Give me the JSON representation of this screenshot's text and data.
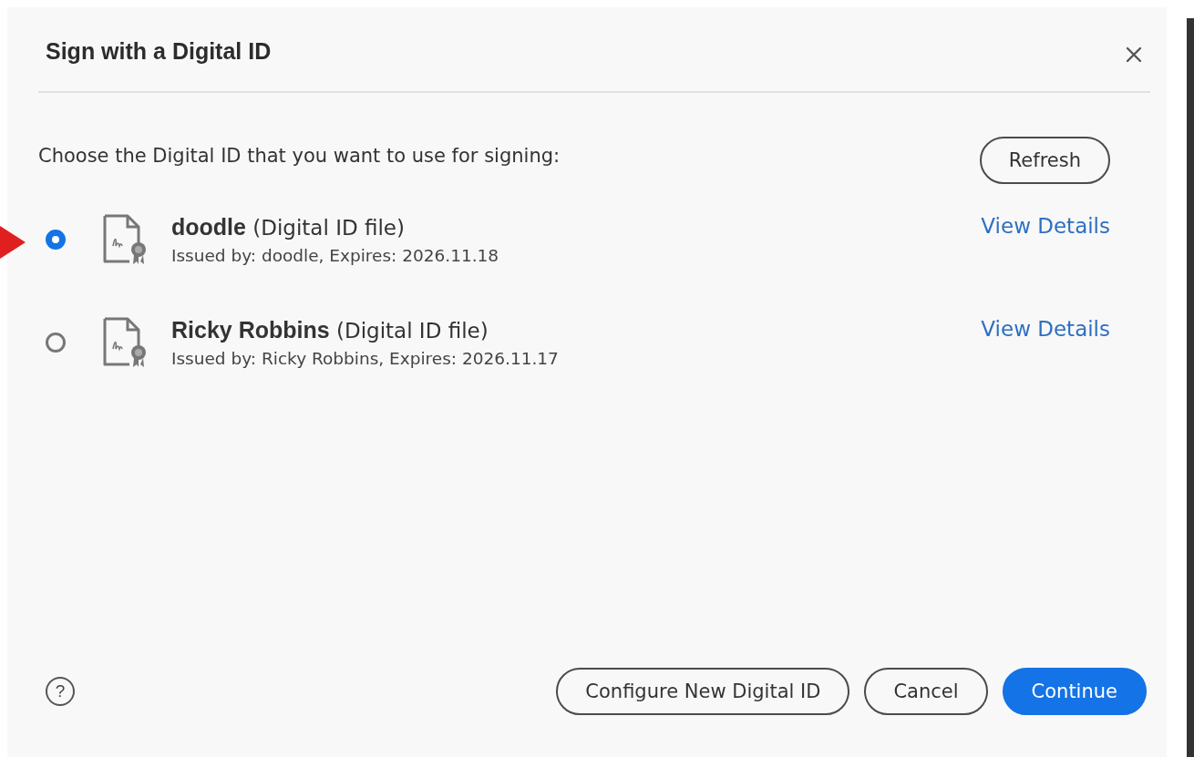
{
  "dialog": {
    "title": "Sign with a Digital ID",
    "prompt": "Choose the Digital ID that you want to use for signing:",
    "refresh_button": "Refresh"
  },
  "digital_ids": [
    {
      "name": "**doodle** (Digital ID file)",
      "issued": "Issued by: doodle, Expires: 2026.11.18",
      "link": "View Details",
      "selected": true
    },
    {
      "name": "**Ricky Robbins** (Digital ID file)",
      "issued": "Issued by: Ricky Robbins, Expires: 2026.11.17",
      "link": "View Details",
      "selected": false
    }
  ],
  "footer": {
    "help": "?",
    "buttons": [
      {
        "label": "Configure New Digital ID",
        "kind": "secondary"
      },
      {
        "label": "Cancel",
        "kind": "secondary"
      },
      {
        "label": "Continue",
        "kind": "primary"
      }
    ]
  }
}
